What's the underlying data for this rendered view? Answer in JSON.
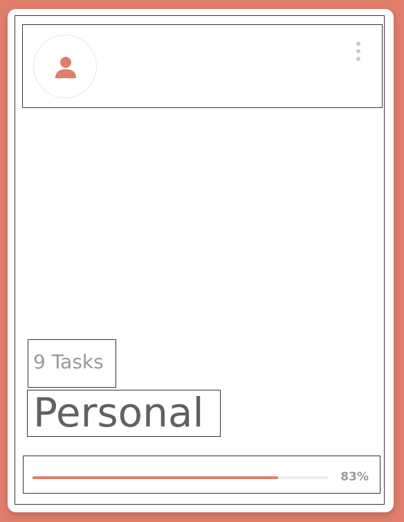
{
  "card": {
    "task_count": "9 Tasks",
    "title": "Personal",
    "progress_label": "83%",
    "progress_fraction": 0.83
  },
  "icons": {
    "avatar": "user-icon",
    "menu": "vertical-dots-icon"
  },
  "colors": {
    "accent": "#e07e6c",
    "title_text": "#5f6162",
    "muted_text": "#9a9a9a",
    "track": "#eeeeee"
  }
}
